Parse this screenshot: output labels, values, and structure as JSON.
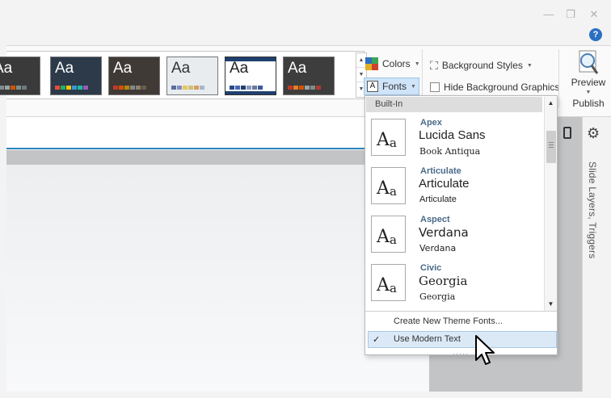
{
  "window": {
    "minimize_glyph": "—",
    "restore_glyph": "❐",
    "close_glyph": "✕",
    "help_glyph": "?"
  },
  "ribbon": {
    "theme_gallery": [
      {
        "label": "Aa",
        "bg": "#3a3a3a",
        "text": "#ffffff",
        "swatches": [
          "#c0392b",
          "#7f8c8d",
          "#95a5a6",
          "#d35400",
          "#7f8c8d",
          "#6d7b7b"
        ]
      },
      {
        "label": "Aa",
        "bg": "#2c3a4a",
        "text": "#ffffff",
        "swatches": [
          "#e74c3c",
          "#27ae60",
          "#f1c40f",
          "#3498db",
          "#1abc9c",
          "#9b59b6"
        ]
      },
      {
        "label": "Aa",
        "bg": "#403a36",
        "text": "#ffffff",
        "swatches": [
          "#c0392b",
          "#d35400",
          "#b8860b",
          "#7f8c8d",
          "#8e7f6f",
          "#6b5b4b"
        ]
      },
      {
        "label": "Aa",
        "bg": "#e8ecef",
        "text": "#333333",
        "swatches": [
          "#5d6d9e",
          "#7f8fbf",
          "#e6c65c",
          "#cbbf7a",
          "#d6a05a",
          "#a9b6c9"
        ]
      },
      {
        "label": "Aa",
        "bg": "#ffffff",
        "text": "#222222",
        "swatches": [
          "#2a4a8a",
          "#4a6ab0",
          "#1f3f6f",
          "#8a9ac0",
          "#6a7a9a",
          "#3a5a9a"
        ]
      },
      {
        "label": "Aa",
        "bg": "#3d3d3d",
        "text": "#ffffff",
        "swatches": [
          "#c0392b",
          "#e67e22",
          "#d35400",
          "#95a5a6",
          "#7f8c8d",
          "#b03a2e"
        ]
      }
    ],
    "colors_label": "Colors",
    "fonts_label": "Fonts",
    "background_styles_label": "Background Styles",
    "hide_background_label": "Hide Background Graphics",
    "preview_label": "Preview",
    "publish_label": "Publish"
  },
  "side_panel": {
    "label": "Slide Layers, Triggers"
  },
  "fonts_dropdown": {
    "header": "Built-In",
    "items": [
      {
        "name": "Apex",
        "heading_font": "Lucida Sans",
        "body_font": "Book Antiqua"
      },
      {
        "name": "Articulate",
        "heading_font": "Articulate",
        "body_font": "Articulate"
      },
      {
        "name": "Aspect",
        "heading_font": "Verdana",
        "body_font": "Verdana"
      },
      {
        "name": "Civic",
        "heading_font": "Georgia",
        "body_font": "Georgia"
      }
    ],
    "create_new": "Create New Theme Fonts...",
    "use_modern_text": "Use Modern Text",
    "use_modern_text_checked": "✓"
  }
}
